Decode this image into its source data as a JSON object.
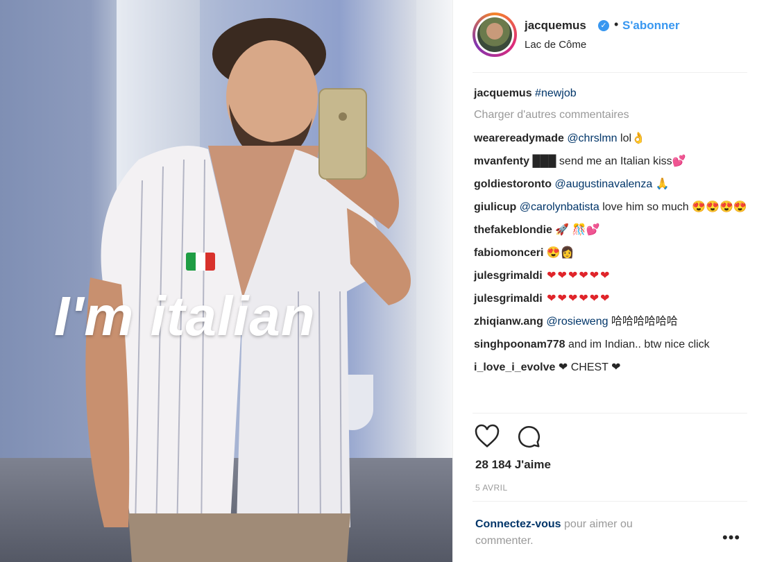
{
  "post": {
    "caption_overlay": "I'm italian",
    "flag": "flag-italy"
  },
  "header": {
    "username": "jacquemus",
    "verified_mark": "✓",
    "separator": "•",
    "follow_label": "S'abonner",
    "location": "Lac de Côme"
  },
  "caption": {
    "user": "jacquemus",
    "text": "#newjob"
  },
  "load_more": "Charger d'autres commentaires",
  "comments": [
    {
      "user": "wearereadymade",
      "mention": "@chrslmn",
      "text": " lol👌"
    },
    {
      "user": "mvanfenty",
      "mention": "",
      "text": " ███ send me an Italian kiss💕"
    },
    {
      "user": "goldiestoronto",
      "mention": "@augustinavalenza",
      "text": " 🙏"
    },
    {
      "user": "giulicup",
      "mention": "@carolynbatista",
      "text": " love him so much 😍😍😍😍"
    },
    {
      "user": "thefakeblondie",
      "mention": "",
      "text": " 🚀 🎊💕"
    },
    {
      "user": "fabiomonceri",
      "mention": "",
      "text": " 😍👩"
    },
    {
      "user": "julesgrimaldi",
      "mention": "",
      "text": " ❤❤❤❤❤❤"
    },
    {
      "user": "julesgrimaldi",
      "mention": "",
      "text": " ❤❤❤❤❤❤"
    },
    {
      "user": "zhiqianw.ang",
      "mention": "@rosieweng",
      "text": " 哈哈哈哈哈哈"
    },
    {
      "user": "singhpoonam778",
      "mention": "",
      "text": " and im Indian.. btw nice click"
    },
    {
      "user": "i_love_i_evolve",
      "mention": "",
      "text": " ❤ CHEST ❤"
    }
  ],
  "actions": {
    "like_icon": "heart-icon",
    "comment_icon": "comment-icon"
  },
  "likes": "28 184 J'aime",
  "date": "5 AVRIL",
  "login": {
    "link": "Connectez-vous",
    "text": " pour aimer ou commenter."
  },
  "more_options": "•••",
  "colors": {
    "link_blue": "#3897f0",
    "mention_blue": "#003569",
    "heart_red": "#e0242a",
    "muted": "#999999"
  }
}
